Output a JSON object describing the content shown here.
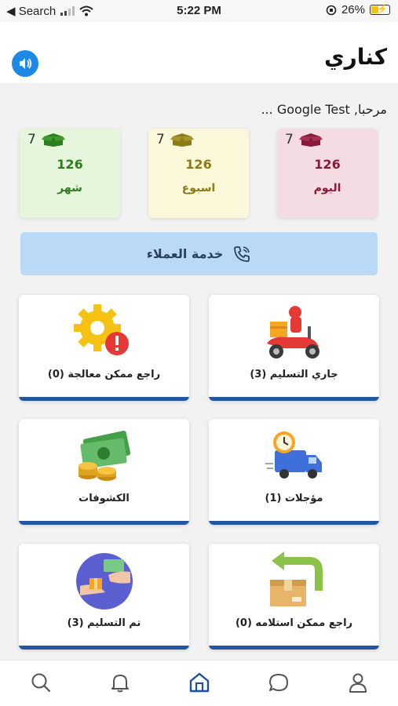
{
  "status_bar": {
    "back_label": "◀ Search",
    "time": "5:22 PM",
    "battery_percent": "26%"
  },
  "header": {
    "title": "كناري",
    "speaker_icon": "speaker-icon"
  },
  "greeting": "مرحبا, Google Test ...",
  "stats": [
    {
      "count": "7",
      "value": "126",
      "label": "اليوم",
      "color": "#8b1a3a",
      "bg": "#f3dde2"
    },
    {
      "count": "7",
      "value": "126",
      "label": "اسبوع",
      "color": "#8a7a1a",
      "bg": "#faf8d8"
    },
    {
      "count": "7",
      "value": "126",
      "label": "شهر",
      "color": "#2e7d1e",
      "bg": "#e6f6dc"
    }
  ],
  "support": {
    "label": "خدمة العملاء",
    "icon": "phone-icon"
  },
  "cards": [
    {
      "label": "جاري التسليم (3)",
      "icon": "delivery-scooter-icon"
    },
    {
      "label": "راجع ممكن معالجة (0)",
      "icon": "gear-alert-icon"
    },
    {
      "label": "مؤجلات (1)",
      "icon": "delivery-truck-clock-icon"
    },
    {
      "label": "الكشوفات",
      "icon": "money-coins-icon"
    },
    {
      "label": "راجع ممكن استلامه (0)",
      "icon": "return-box-icon"
    },
    {
      "label": "تم التسليم (3)",
      "icon": "handover-icon"
    }
  ],
  "bottom_nav": [
    {
      "icon": "search-icon"
    },
    {
      "icon": "bell-icon"
    },
    {
      "icon": "home-icon",
      "active": true
    },
    {
      "icon": "chat-icon"
    },
    {
      "icon": "user-icon"
    }
  ]
}
